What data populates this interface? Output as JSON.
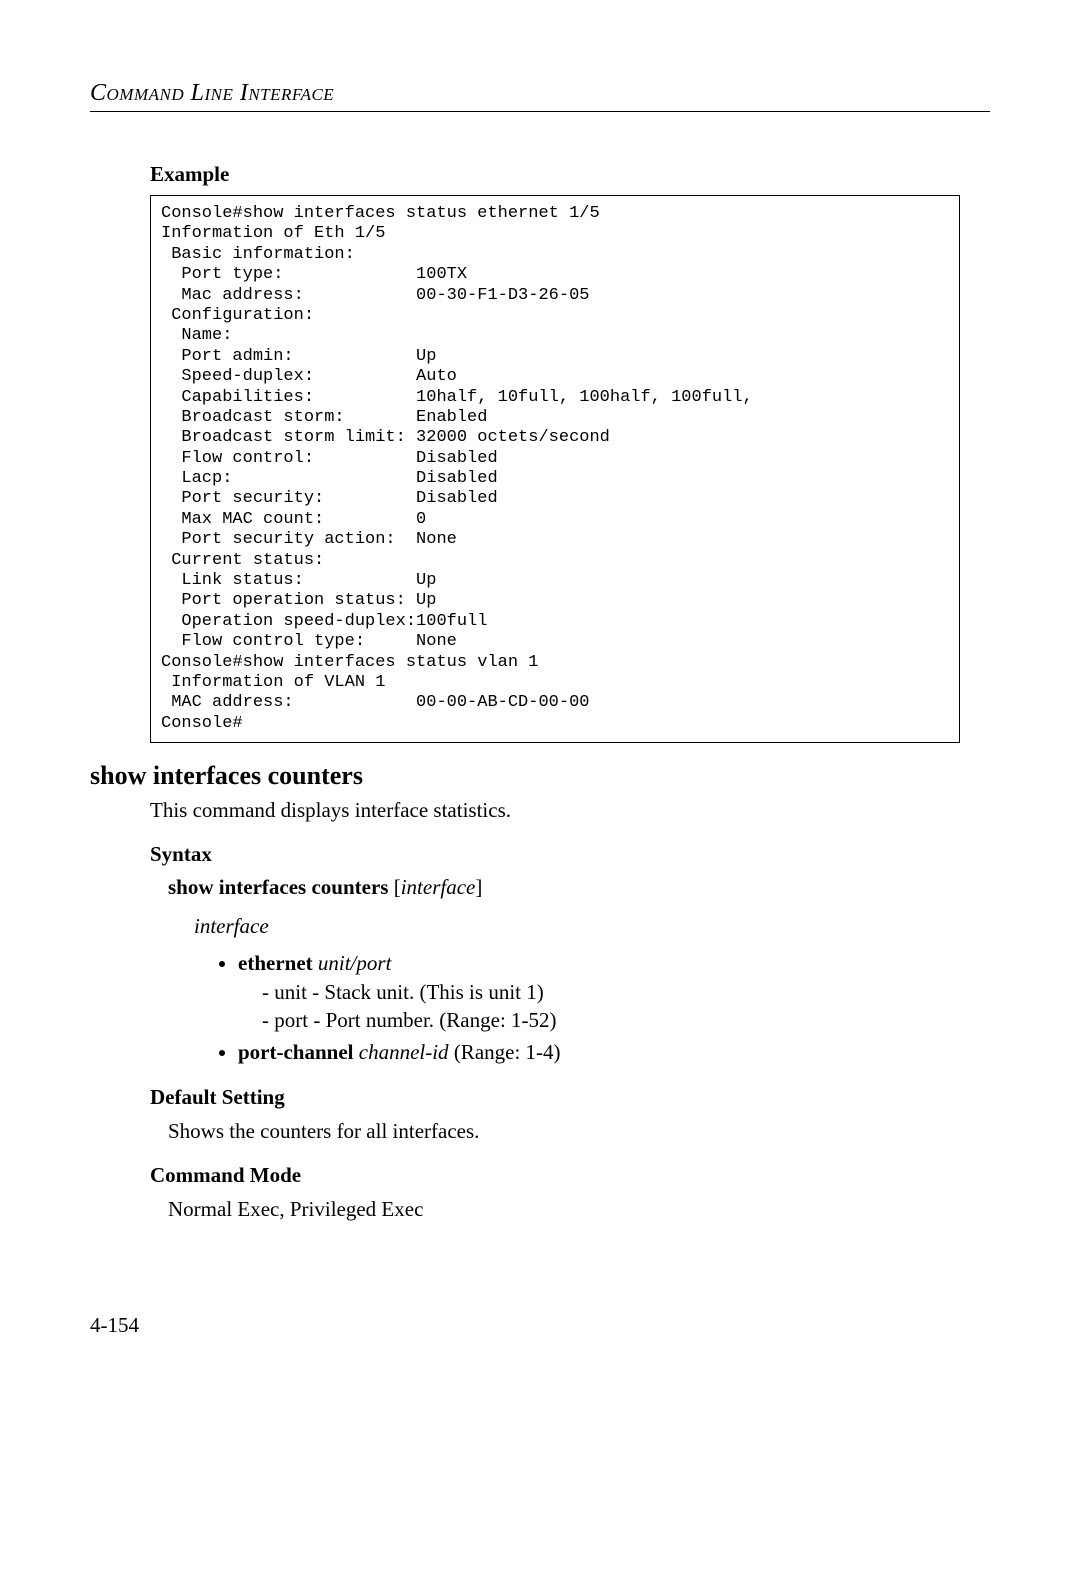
{
  "header": {
    "title": "Command Line Interface"
  },
  "section1": {
    "heading": "Example",
    "code": "Console#show interfaces status ethernet 1/5\nInformation of Eth 1/5\n Basic information:\n  Port type:             100TX\n  Mac address:           00-30-F1-D3-26-05\n Configuration:\n  Name:\n  Port admin:            Up\n  Speed-duplex:          Auto\n  Capabilities:          10half, 10full, 100half, 100full,\n  Broadcast storm:       Enabled\n  Broadcast storm limit: 32000 octets/second\n  Flow control:          Disabled\n  Lacp:                  Disabled\n  Port security:         Disabled\n  Max MAC count:         0\n  Port security action:  None\n Current status:\n  Link status:           Up\n  Port operation status: Up\n  Operation speed-duplex:100full\n  Flow control type:     None\nConsole#show interfaces status vlan 1\n Information of VLAN 1\n MAC address:            00-00-AB-CD-00-00\nConsole#"
  },
  "command": {
    "title": "show interfaces counters",
    "description": "This command displays interface statistics.",
    "syntax_heading": "Syntax",
    "syntax_cmd_bold": "show interfaces counters",
    "syntax_cmd_bracket_open": " [",
    "syntax_cmd_param": "interface",
    "syntax_cmd_bracket_close": "]",
    "interface_word": "interface",
    "eth_bold": "ethernet",
    "eth_param": " unit/port",
    "eth_unit_line": "-  unit - Stack unit. (This is unit 1)",
    "eth_port_line": "-  port - Port number. (Range: 1-52)",
    "pc_bold": "port-channel",
    "pc_param": " channel-id",
    "pc_rest": " (Range: 1-4)",
    "default_heading": "Default Setting",
    "default_text": "Shows the counters for all interfaces.",
    "mode_heading": "Command Mode",
    "mode_text": "Normal Exec, Privileged Exec"
  },
  "page_number": "4-154"
}
